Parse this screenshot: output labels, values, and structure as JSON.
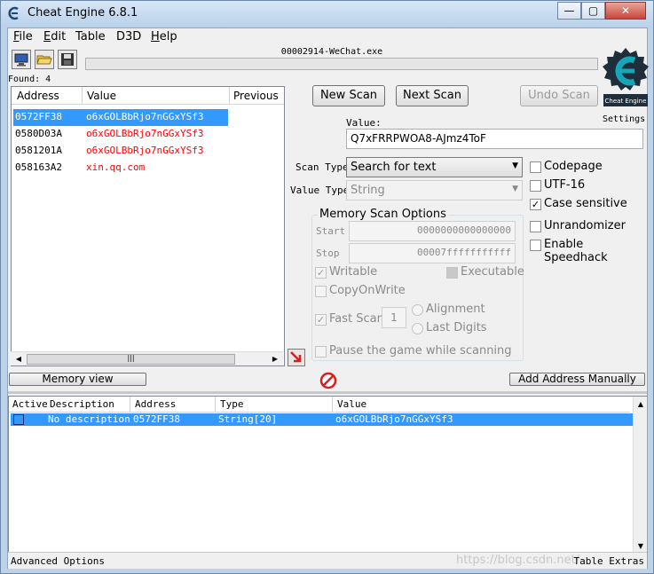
{
  "window": {
    "title": "Cheat Engine 6.8.1",
    "buttons": {
      "minimize": "—",
      "maximize": "▢",
      "close": "✕"
    }
  },
  "menu": [
    {
      "label": "File",
      "underline": "F",
      "rest": "ile"
    },
    {
      "label": "Edit",
      "underline": "E",
      "rest": "dit"
    },
    {
      "label": "Table",
      "underline": "",
      "rest": "Table"
    },
    {
      "label": "D3D",
      "underline": "",
      "rest": "D3D"
    },
    {
      "label": "Help",
      "underline": "H",
      "rest": "elp"
    }
  ],
  "toolbar": {
    "process_name": "00002914-WeChat.exe",
    "found_label": "Found: 4",
    "settings_label": "Settings",
    "logo_caption": "Cheat Engine"
  },
  "results": {
    "headers": {
      "address": "Address",
      "value": "Value",
      "previous": "Previous"
    },
    "rows": [
      {
        "address": "0572FF38",
        "value": "o6xGOLBbRjo7nGGxYSf3",
        "selected": true
      },
      {
        "address": "0580D03A",
        "value": "o6xGOLBbRjo7nGGxYSf3",
        "selected": false
      },
      {
        "address": "0581201A",
        "value": "o6xGOLBbRjo7nGGxYSf3",
        "selected": false
      },
      {
        "address": "058163A2",
        "value": "xin.qq.com",
        "selected": false
      }
    ],
    "scroll_grip": "|||"
  },
  "scan": {
    "new_scan": "New Scan",
    "next_scan": "Next Scan",
    "undo_scan": "Undo Scan",
    "value_label": "Value:",
    "value": "Q7xFRRPWOA8-AJmz4ToF",
    "scan_type_label": "Scan Type",
    "scan_type": "Search for text",
    "value_type_label": "Value Type",
    "value_type": "String"
  },
  "memory_options": {
    "title": "Memory Scan Options",
    "start_label": "Start",
    "start_value": "0000000000000000",
    "stop_label": "Stop",
    "stop_value": "00007fffffffffff",
    "writable": "Writable",
    "executable": "Executable",
    "copy_on_write": "CopyOnWrite",
    "fast_scan": "Fast Scan",
    "fast_scan_value": "1",
    "alignment": "Alignment",
    "last_digits": "Last Digits",
    "pause_game": "Pause the game while scanning"
  },
  "options": {
    "codepage": "Codepage",
    "utf16": "UTF-16",
    "case_sensitive": "Case sensitive",
    "unrandomizer": "Unrandomizer",
    "speedhack": "Enable Speedhack"
  },
  "bottom": {
    "memory_view": "Memory view",
    "add_address": "Add Address Manually"
  },
  "address_list": {
    "headers": {
      "active": "Active",
      "description": "Description",
      "address": "Address",
      "type": "Type",
      "value": "Value"
    },
    "rows": [
      {
        "description": "No description",
        "address": "0572FF38",
        "type": "String[20]",
        "value": "o6xGOLBbRjo7nGGxYSf3"
      }
    ]
  },
  "status": {
    "advanced": "Advanced Options",
    "table_extras": "Table Extras",
    "watermark": "https://blog.csdn.net/"
  },
  "colors": {
    "selection": "#3399ff",
    "result_value_red": "#ff0000",
    "logo_teal": "#0e8a9a"
  }
}
